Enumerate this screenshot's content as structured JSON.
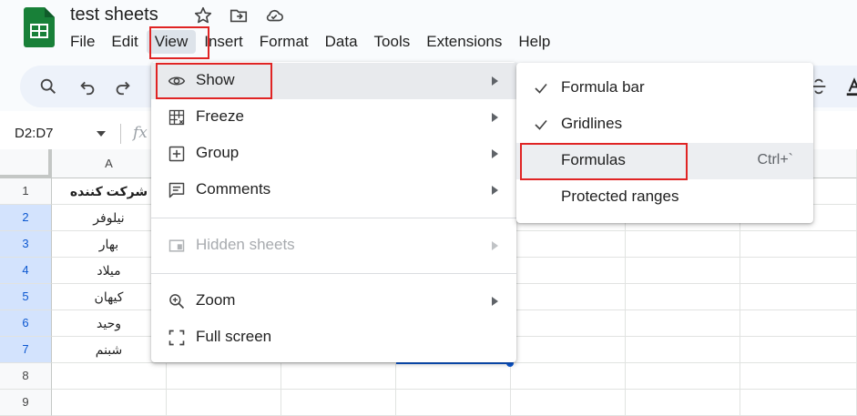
{
  "doc": {
    "title": "test sheets"
  },
  "menubar": [
    "File",
    "Edit",
    "View",
    "Insert",
    "Format",
    "Data",
    "Tools",
    "Extensions",
    "Help"
  ],
  "namebox": {
    "value": "D2:D7"
  },
  "formula": {
    "fx": "fx"
  },
  "grid": {
    "columns": [
      "A"
    ],
    "rows": [
      "1",
      "2",
      "3",
      "4",
      "5",
      "6",
      "7",
      "8",
      "9"
    ],
    "colA": [
      "شرکت کننده",
      "نیلوفر",
      "بهار",
      "میلاد",
      "کیهان",
      "وحید",
      "شبنم",
      "",
      ""
    ]
  },
  "view_menu": {
    "items": [
      {
        "label": "Show",
        "icon": "eye-icon",
        "submenu": true
      },
      {
        "label": "Freeze",
        "icon": "freeze-icon",
        "submenu": true
      },
      {
        "label": "Group",
        "icon": "group-plus-icon",
        "submenu": true
      },
      {
        "label": "Comments",
        "icon": "comment-icon",
        "submenu": true
      },
      {
        "label": "Hidden sheets",
        "icon": "hidden-sheet-icon",
        "submenu": true,
        "disabled": true
      },
      {
        "label": "Zoom",
        "icon": "zoom-icon",
        "submenu": true
      },
      {
        "label": "Full screen",
        "icon": "fullscreen-icon",
        "submenu": false
      }
    ]
  },
  "show_submenu": {
    "items": [
      {
        "label": "Formula bar",
        "checked": true,
        "shortcut": ""
      },
      {
        "label": "Gridlines",
        "checked": true,
        "shortcut": ""
      },
      {
        "label": "Formulas",
        "checked": false,
        "shortcut": "Ctrl+`"
      },
      {
        "label": "Protected ranges",
        "checked": false,
        "shortcut": ""
      }
    ]
  },
  "colors": {
    "accent": "#0b57d0",
    "highlight": "#e02424",
    "sheets_green": "#188038"
  }
}
